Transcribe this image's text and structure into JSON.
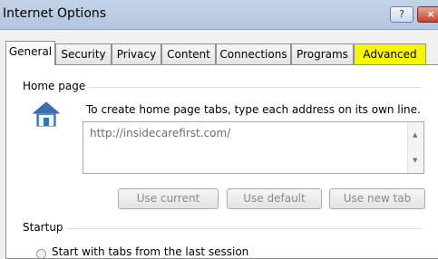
{
  "window": {
    "title": "Internet Options",
    "help_label": "?",
    "close_label": "×"
  },
  "tabs": [
    {
      "label": "General"
    },
    {
      "label": "Security"
    },
    {
      "label": "Privacy"
    },
    {
      "label": "Content"
    },
    {
      "label": "Connections"
    },
    {
      "label": "Programs"
    },
    {
      "label": "Advanced"
    }
  ],
  "home_page": {
    "group_label": "Home page",
    "hint": "To create home page tabs, type each address on its own line.",
    "address_value": "http://insidecarefirst.com/",
    "icon": "house-icon"
  },
  "buttons": {
    "use_current": "Use current",
    "use_default": "Use default",
    "use_new_tab": "Use new tab"
  },
  "startup": {
    "group_label": "Startup",
    "option_label": "Start with tabs from the last session"
  },
  "colors": {
    "advanced_tab_highlight": "#f6f600",
    "title_bar": "#b3c6e0",
    "close_button": "#c7432e"
  }
}
